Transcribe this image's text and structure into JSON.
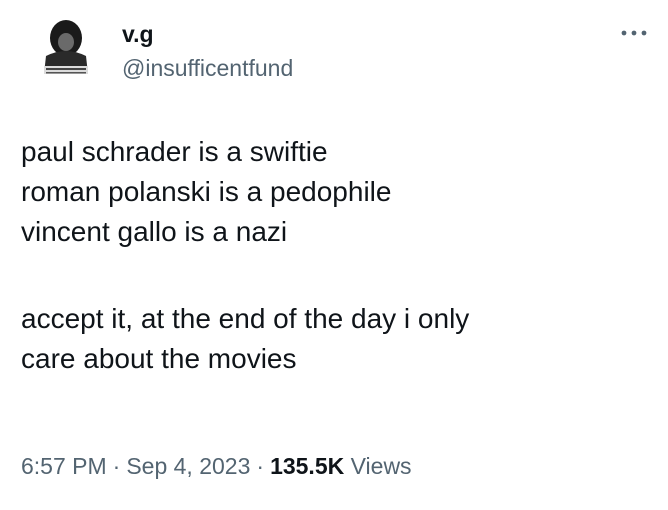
{
  "author": {
    "display_name": "v.g",
    "handle": "@insufficentfund",
    "avatar_icon": "profile-photo"
  },
  "more_icon": "more-dots-icon",
  "tweet": {
    "lines": [
      "paul schrader is a swiftie",
      "roman polanski is a pedophile",
      "vincent gallo is a nazi",
      "accept it, at the end of the day i only",
      "care about the movies"
    ]
  },
  "meta": {
    "time": "6:57 PM",
    "separator": "·",
    "date": "Sep 4, 2023",
    "views_count": "135.5K",
    "views_label": "Views"
  },
  "colors": {
    "text": "#0f1419",
    "secondary": "#536471"
  }
}
